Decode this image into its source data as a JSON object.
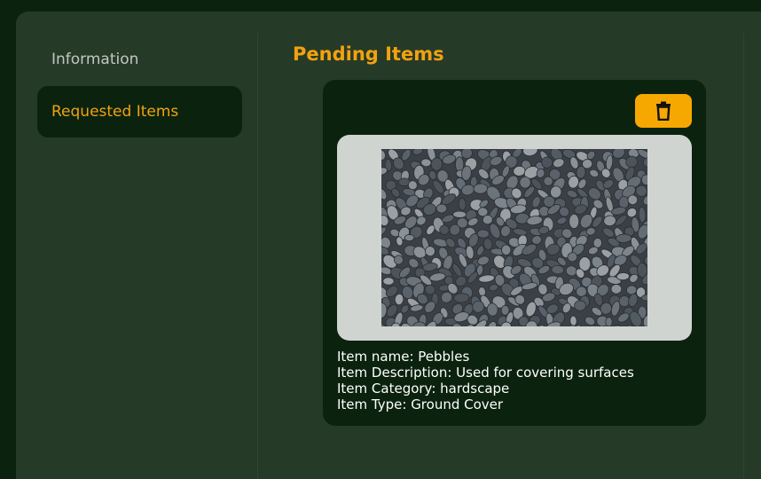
{
  "sidebar": {
    "items": [
      {
        "label": "Information",
        "active": false
      },
      {
        "label": "Requested Items",
        "active": true
      }
    ]
  },
  "main": {
    "title": "Pending Items",
    "card": {
      "delete_icon": "trash-icon",
      "image_alt": "Pebbles",
      "details": {
        "name": "Item name: Pebbles",
        "description": "Item Description: Used for covering surfaces",
        "category": "Item Category: hardscape",
        "type": "Item Type: Ground Cover"
      }
    }
  },
  "colors": {
    "background": "#0b230e",
    "panel": "#263a28",
    "accent": "#f2a20f",
    "delete_button": "#f7a800",
    "image_frame": "#d0d4d0"
  }
}
